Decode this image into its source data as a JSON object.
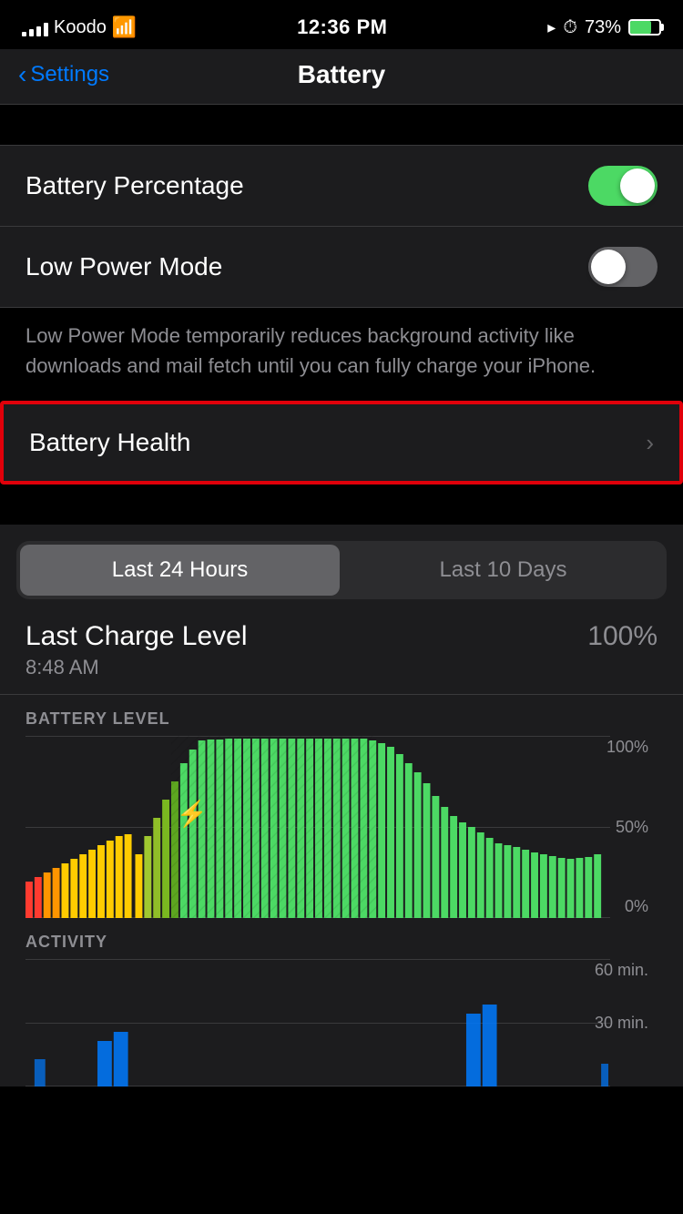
{
  "statusBar": {
    "carrier": "Koodo",
    "time": "12:36 PM",
    "batteryPct": "73%",
    "signalBars": [
      4,
      7,
      10,
      14,
      17
    ]
  },
  "navBar": {
    "backLabel": "Settings",
    "title": "Battery"
  },
  "settings": {
    "batteryPercentage": {
      "label": "Battery Percentage",
      "toggleOn": true
    },
    "lowPowerMode": {
      "label": "Low Power Mode",
      "toggleOn": false
    },
    "lowPowerDescription": "Low Power Mode temporarily reduces background activity like downloads and mail fetch until you can fully charge your iPhone.",
    "batteryHealth": {
      "label": "Battery Health",
      "chevron": "›"
    }
  },
  "timeSegment": {
    "options": [
      "Last 24 Hours",
      "Last 10 Days"
    ],
    "activeIndex": 0
  },
  "chargeLevel": {
    "title": "Last Charge Level",
    "time": "8:48 AM",
    "percentage": "100%"
  },
  "batteryChart": {
    "sectionLabel": "BATTERY LEVEL",
    "yLabels": [
      "100%",
      "50%",
      "0%"
    ]
  },
  "activityChart": {
    "sectionLabel": "ACTIVITY",
    "yLabels": [
      "60 min.",
      "30 min."
    ]
  }
}
